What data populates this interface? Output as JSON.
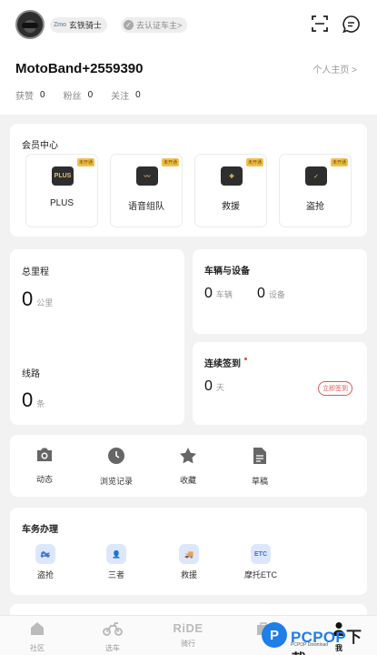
{
  "header": {
    "level_icon_text": "Zmo",
    "level_badge": "玄铁骑士",
    "verify_badge": "去认证车主>",
    "username": "MotoBand+2559390",
    "profile_link": "个人主页 >",
    "stats": [
      {
        "label": "获赞",
        "value": "0"
      },
      {
        "label": "粉丝",
        "value": "0"
      },
      {
        "label": "关注",
        "value": "0"
      }
    ]
  },
  "membership": {
    "title": "会员中心",
    "items": [
      {
        "label": "PLUS",
        "icon_text": "PLUS",
        "tag": "未开通",
        "icon": "plus-icon"
      },
      {
        "label": "语音组队",
        "icon_text": "〰",
        "tag": "未开通",
        "icon": "voice-wave-icon"
      },
      {
        "label": "救援",
        "icon_text": "✚",
        "tag": "未开通",
        "icon": "rescue-icon"
      },
      {
        "label": "盗抢",
        "icon_text": "✓",
        "tag": "未开通",
        "icon": "shield-icon"
      }
    ]
  },
  "mileage": {
    "title": "总里程",
    "value": "0",
    "unit": "公里"
  },
  "routes": {
    "title": "线路",
    "value": "0",
    "unit": "条"
  },
  "vehicles": {
    "title": "车辆与设备",
    "vehicle_value": "0",
    "vehicle_unit": "车辆",
    "device_value": "0",
    "device_unit": "设备"
  },
  "checkin": {
    "title": "连续签到",
    "value": "0",
    "unit": "天",
    "button": "立即签到"
  },
  "quick_actions": [
    {
      "label": "动态",
      "icon": "camera-icon"
    },
    {
      "label": "浏览记录",
      "icon": "clock-icon"
    },
    {
      "label": "收藏",
      "icon": "star-icon"
    },
    {
      "label": "草稿",
      "icon": "draft-icon"
    }
  ],
  "services": {
    "title": "车务办理",
    "items": [
      {
        "label": "盗抢",
        "icon_text": "🏍",
        "icon": "theft-icon"
      },
      {
        "label": "三者",
        "icon_text": "👤",
        "icon": "third-party-icon"
      },
      {
        "label": "救援",
        "icon_text": "🚚",
        "icon": "tow-truck-icon"
      },
      {
        "label": "摩托ETC",
        "icon_text": "ETC",
        "icon": "etc-icon"
      }
    ]
  },
  "tabbar": [
    {
      "label": "社区",
      "icon": "home-icon"
    },
    {
      "label": "选车",
      "icon": "motorcycle-icon"
    },
    {
      "label": "骑行",
      "icon_text": "RiDE",
      "icon": "ride-icon"
    },
    {
      "label": "",
      "icon": "shop-icon"
    },
    {
      "label": "我",
      "icon": "person-icon",
      "active": true
    }
  ],
  "watermark": {
    "logo": "P",
    "brand_a": "PCPOP",
    "brand_b": "下载",
    "sub": "PCPOP Download"
  },
  "colors": {
    "accent_red": "#e05757",
    "service_blue": "#3d6fd6",
    "vip_gold": "#f3c14a"
  }
}
